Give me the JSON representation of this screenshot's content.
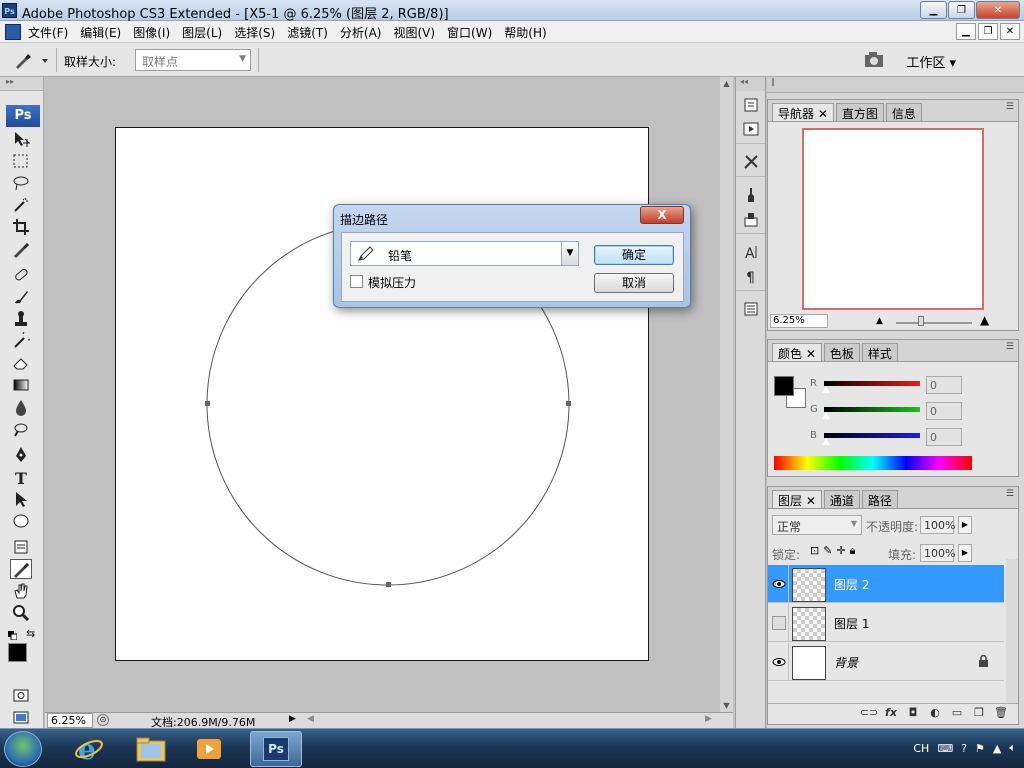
{
  "window": {
    "title": "Adobe Photoshop CS3 Extended - [X5-1 @ 6.25% (图层 2, RGB/8)]",
    "buttons": [
      "minimize",
      "restore",
      "close"
    ]
  },
  "menu": {
    "items": [
      "文件(F)",
      "编辑(E)",
      "图像(I)",
      "图层(L)",
      "选择(S)",
      "滤镜(T)",
      "分析(A)",
      "视图(V)",
      "窗口(W)",
      "帮助(H)"
    ]
  },
  "options_bar": {
    "sample_size_label": "取样大小:",
    "sample_size_value": "取样点",
    "workspace_label": "工作区 ▾"
  },
  "toolbox": {
    "logo": "Ps",
    "tools": [
      "move-tool",
      "marquee-tool",
      "lasso-tool",
      "magic-wand-tool",
      "crop-tool",
      "eyedropper-tool",
      "healing-brush-tool",
      "brush-tool",
      "clone-stamp-tool",
      "history-brush-tool",
      "eraser-tool",
      "gradient-tool",
      "blur-tool",
      "dodge-tool",
      "pen-tool",
      "type-tool",
      "path-selection-tool",
      "ellipse-tool",
      "notes-tool",
      "eyedropper-tool-active",
      "hand-tool",
      "zoom-tool"
    ]
  },
  "status": {
    "zoom": "6.25%",
    "doc_info": "文档:206.9M/9.76M"
  },
  "dialog": {
    "title": "描边路径",
    "close": "X",
    "tool_value": "铅笔",
    "simulate_pressure_label": "模拟压力",
    "simulate_pressure_checked": false,
    "ok_label": "确定",
    "cancel_label": "取消"
  },
  "navigator": {
    "tabs": [
      "导航器",
      "直方图",
      "信息"
    ],
    "zoom": "6.25%"
  },
  "color": {
    "tabs": [
      "颜色",
      "色板",
      "样式"
    ],
    "channels": [
      {
        "label": "R",
        "value": "0",
        "color": "#e02020"
      },
      {
        "label": "G",
        "value": "0",
        "color": "#20c020"
      },
      {
        "label": "B",
        "value": "0",
        "color": "#2020e0"
      }
    ],
    "foreground": "#000000",
    "background": "#ffffff"
  },
  "layers": {
    "tabs": [
      "图层",
      "通道",
      "路径"
    ],
    "blend_mode": "正常",
    "opacity_label": "不透明度:",
    "opacity_value": "100%",
    "lock_label": "锁定:",
    "fill_label": "填充:",
    "fill_value": "100%",
    "items": [
      {
        "name": "图层 2",
        "visible": true,
        "selected": true,
        "locked": false
      },
      {
        "name": "图层 1",
        "visible": false,
        "selected": false,
        "locked": false
      },
      {
        "name": "背景",
        "visible": true,
        "selected": false,
        "locked": true
      }
    ],
    "bottom_icons": [
      "link-icon",
      "fx-icon",
      "mask-icon",
      "adjustment-icon",
      "group-icon",
      "new-layer-icon",
      "trash-icon"
    ]
  },
  "taskbar": {
    "apps": [
      "ie-icon",
      "folder-icon",
      "media-player-icon",
      "photoshop-icon"
    ],
    "active_app_label": "Ps",
    "language": "CH"
  }
}
